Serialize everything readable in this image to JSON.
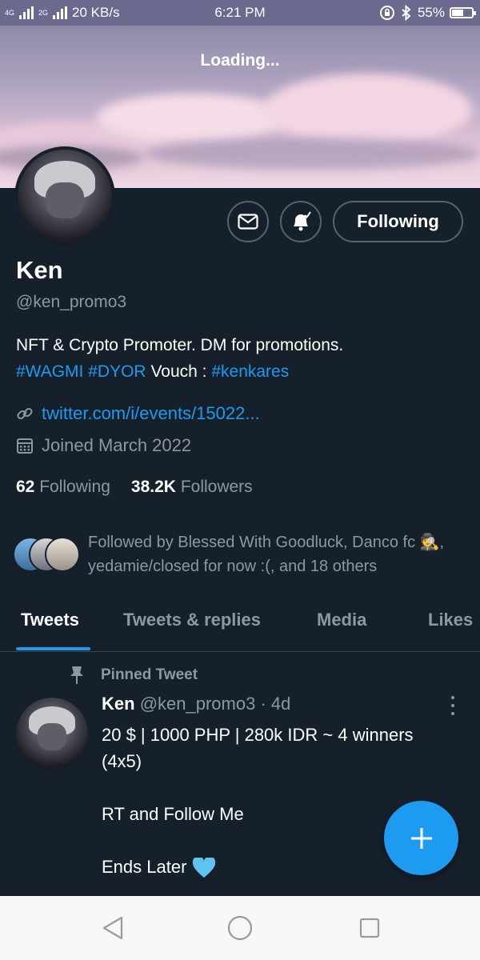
{
  "status_bar": {
    "network_1": "4G",
    "network_2": "2G",
    "speed": "20 KB/s",
    "time": "6:21 PM",
    "battery_percent": "55%",
    "battery_level": 0.55
  },
  "banner": {
    "loading_text": "Loading..."
  },
  "actions": {
    "following_label": "Following"
  },
  "profile": {
    "name": "Ken",
    "handle": "@ken_promo3",
    "bio_line1": "NFT & Crypto Promoter. DM for promotions.",
    "bio_tag1": "#WAGMI",
    "bio_tag2": "#DYOR",
    "bio_vouch": "Vouch :",
    "bio_tag3": "#kenkares",
    "website": "twitter.com/i/events/15022...",
    "joined": "Joined March 2022",
    "following_count": "62",
    "following_label": "Following",
    "followers_count": "38.2K",
    "followers_label": "Followers",
    "followed_by": "Followed by Blessed With Goodluck, Danco fc 🕵️, yedamie/closed for now :(, and 18 others"
  },
  "tabs": [
    "Tweets",
    "Tweets & replies",
    "Media",
    "Likes"
  ],
  "tweet": {
    "pinned_label": "Pinned Tweet",
    "author": "Ken",
    "handle": "@ken_promo3",
    "time": "· 4d",
    "body": "20 $ | 1000 PHP | 280k IDR ~ 4 winners\n(4x5)\n\nRT and Follow Me\n\nEnds Later"
  },
  "colors": {
    "background": "#15202b",
    "accent": "#1d9bf0",
    "secondary_text": "#8b98a5",
    "border": "#536471"
  }
}
